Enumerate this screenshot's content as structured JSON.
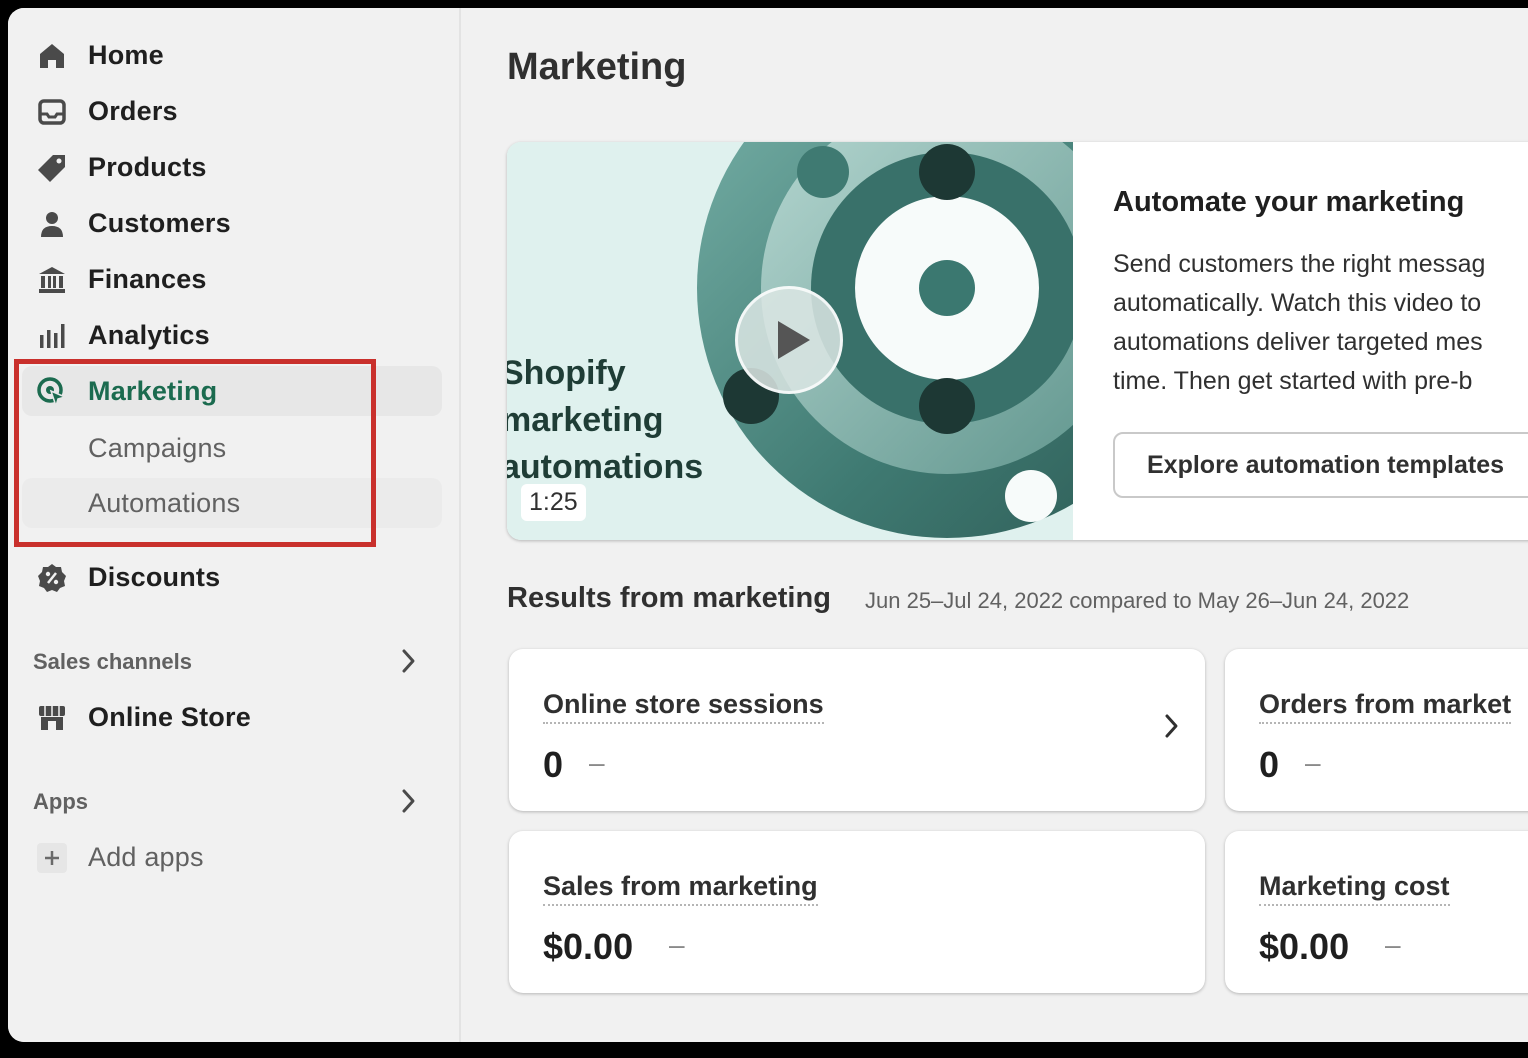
{
  "sidebar": {
    "items": [
      {
        "label": "Home",
        "icon": "home-icon"
      },
      {
        "label": "Orders",
        "icon": "inbox-icon"
      },
      {
        "label": "Products",
        "icon": "tag-icon"
      },
      {
        "label": "Customers",
        "icon": "person-icon"
      },
      {
        "label": "Finances",
        "icon": "bank-icon"
      },
      {
        "label": "Analytics",
        "icon": "bar-chart-icon"
      },
      {
        "label": "Marketing",
        "icon": "target-icon"
      }
    ],
    "sub_items": [
      {
        "label": "Campaigns"
      },
      {
        "label": "Automations"
      }
    ],
    "discounts": {
      "label": "Discounts",
      "icon": "discount-icon"
    },
    "sales_channels": {
      "title": "Sales channels"
    },
    "online_store": {
      "label": "Online Store",
      "icon": "store-icon"
    },
    "apps": {
      "title": "Apps"
    },
    "add_apps": {
      "label": "Add apps"
    },
    "accent_color": "#1b6b4f",
    "highlight_color": "#c9302c"
  },
  "main": {
    "page_title": "Marketing",
    "promo": {
      "video_lines": [
        "Shopify",
        "marketing",
        "automations"
      ],
      "duration": "1:25",
      "title": "Automate your marketing",
      "body_lines": [
        "Send customers the right messag",
        "automatically. Watch this video to",
        "automations deliver targeted mes",
        "time. Then get started with pre-b"
      ],
      "button": "Explore automation templates"
    },
    "results": {
      "title": "Results from marketing",
      "range": "Jun 25–Jul 24, 2022 compared to May 26–Jun 24, 2022"
    },
    "metrics": [
      {
        "label": "Online store sessions",
        "value": "0",
        "change": "–"
      },
      {
        "label": "Orders from market",
        "value": "0",
        "change": "–"
      },
      {
        "label": "Sales from marketing",
        "value": "$0.00",
        "change": "–"
      },
      {
        "label": "Marketing cost",
        "value": "$0.00",
        "change": "–"
      }
    ]
  }
}
